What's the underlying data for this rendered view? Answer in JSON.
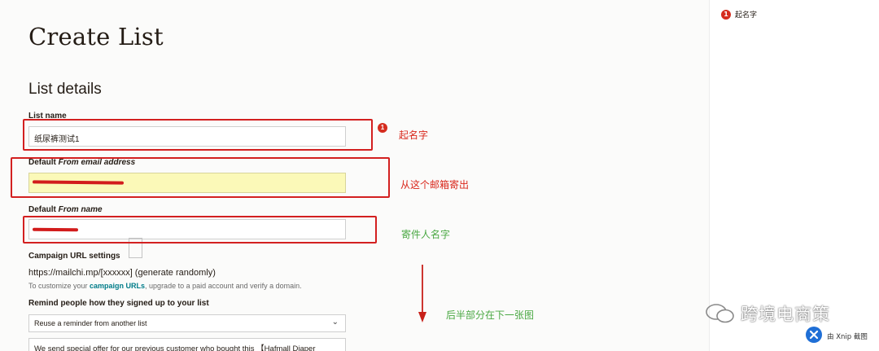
{
  "page": {
    "title": "Create List",
    "section": "List details"
  },
  "fields": {
    "list_name_label": "List name",
    "list_name_value": "纸尿裤测试1",
    "from_email_label_prefix": "Default ",
    "from_email_label_em": "From email address",
    "from_name_label_prefix": "Default ",
    "from_name_label_em": "From name",
    "campaign_url_label": "Campaign URL settings",
    "campaign_url_value": "https://mailchi.mp/[xxxxxx] (generate randomly)",
    "help_prefix": "To customize your ",
    "help_link": "campaign URLs",
    "help_suffix": ", upgrade to a paid account and verify a domain.",
    "remind_label": "Remind people how they signed up to your list",
    "remind_select": "Reuse a reminder from another list",
    "remind_text": "We send special offer for our previous customer who bought this 【Hafmall Diaper"
  },
  "annotations": {
    "badge_number": "1",
    "name_note": "起名字",
    "email_note": "从这个邮箱寄出",
    "sender_note": "寄件人名字",
    "next_note": "后半部分在下一张图"
  },
  "legend": {
    "badge": "1",
    "text": "起名字"
  },
  "watermark": {
    "text": "跨境电商策",
    "xnip": "由 Xnip 截图"
  },
  "colors": {
    "annotation_red": "#d32020",
    "annotation_green": "#4aa843",
    "highlight_yellow": "#fbf9b8",
    "link_teal": "#007c89"
  }
}
